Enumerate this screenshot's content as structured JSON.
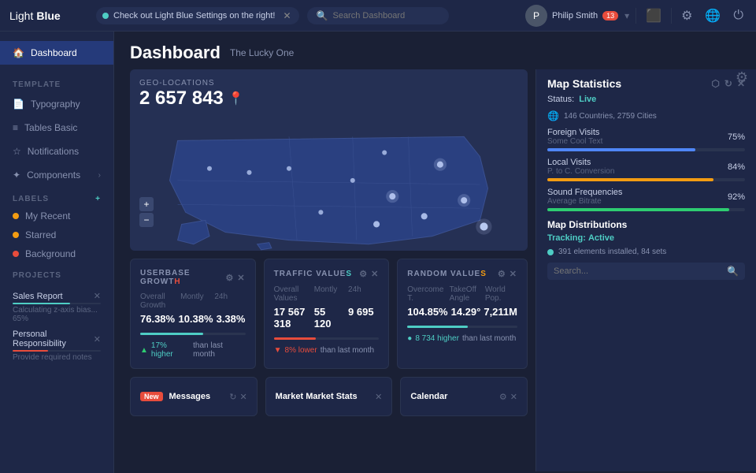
{
  "app": {
    "logo_light": "Light",
    "logo_bold": "Blue"
  },
  "topbar": {
    "tab_text": "Check out Light Blue Settings on the right!",
    "search_placeholder": "Search Dashboard",
    "user_name": "Philip Smith",
    "user_badge": "13"
  },
  "sidebar": {
    "nav_items": [
      {
        "label": "Dashboard",
        "active": true
      },
      {
        "label": "Typography"
      },
      {
        "label": "Tables Basic"
      },
      {
        "label": "Notifications"
      },
      {
        "label": "Components"
      }
    ],
    "labels_title": "LABELS",
    "labels": [
      {
        "label": "My Recent",
        "color": "#f39c12"
      },
      {
        "label": "Starred",
        "color": "#f39c12"
      },
      {
        "label": "Background",
        "color": "#e74c3c"
      }
    ],
    "projects_title": "PROJECTS",
    "projects": [
      {
        "name": "Sales Report",
        "progress": 65,
        "color": "#4ecdc4",
        "sub": "Calculating z-axis bias... 65%"
      },
      {
        "name": "Personal Responsibility",
        "progress": 40,
        "color": "#e74c3c",
        "sub": "Provide required notes"
      }
    ]
  },
  "page": {
    "title": "Dashboard",
    "subtitle": "The Lucky One"
  },
  "map_widget": {
    "label": "GEO-LOCATIONS",
    "count": "2 657 843"
  },
  "map_stats": {
    "title": "Map Statistics",
    "status_label": "Status:",
    "status_value": "Live",
    "countries": "146 Countries, 2759 Cities",
    "metrics": [
      {
        "label": "Foreign Visits",
        "sub": "Some Cool Text",
        "pct": "75%",
        "fill": 75,
        "color": "#4f86f7"
      },
      {
        "label": "Local Visits",
        "sub": "P. to C. Conversion",
        "pct": "84%",
        "fill": 84,
        "color": "#f39c12"
      },
      {
        "label": "Sound Frequencies",
        "sub": "Average Bitrate",
        "pct": "92%",
        "fill": 92,
        "color": "#2ecc71"
      }
    ],
    "distributions_title": "Map Distributions",
    "tracking_label": "Tracking:",
    "tracking_value": "Active",
    "elements_text": "391 elements installed, 84 sets",
    "search_placeholder": "Search..."
  },
  "stat_cards": [
    {
      "id": "userbase",
      "title": "USERBASE GROWTH",
      "accent": "H",
      "headers": [
        "Overall Growth",
        "Montly",
        "24h"
      ],
      "values": [
        "76.38%",
        "10.38%",
        "3.38%"
      ],
      "progress": 60,
      "progress_color": "#4ecdc4",
      "note": "17% higher than last month",
      "note_type": "up"
    },
    {
      "id": "traffic",
      "title": "TRAFFIC VALUES",
      "accent": "S",
      "headers": [
        "Overall Values",
        "Montly",
        "24h"
      ],
      "values": [
        "17 567 318",
        "55 120",
        "9 695"
      ],
      "progress": 40,
      "progress_color": "#e74c3c",
      "note": "8% lower than last month",
      "note_type": "down"
    },
    {
      "id": "random",
      "title": "RANDOM VALUES",
      "accent": "S",
      "headers": [
        "Overcome T.",
        "TakeOff Angle",
        "World Pop."
      ],
      "values": [
        "104.85%",
        "14.29°",
        "7,211M"
      ],
      "progress": 55,
      "progress_color": "#4ecdc4",
      "note": "8 734 higher than last month",
      "note_type": "neutral"
    }
  ],
  "bottom_cards": [
    {
      "id": "messages",
      "badge": "New",
      "title": "Messages",
      "type": "badge"
    },
    {
      "id": "market",
      "title": "Market Stats",
      "type": "plain"
    },
    {
      "id": "calendar",
      "title": "Calendar",
      "type": "plain"
    }
  ]
}
